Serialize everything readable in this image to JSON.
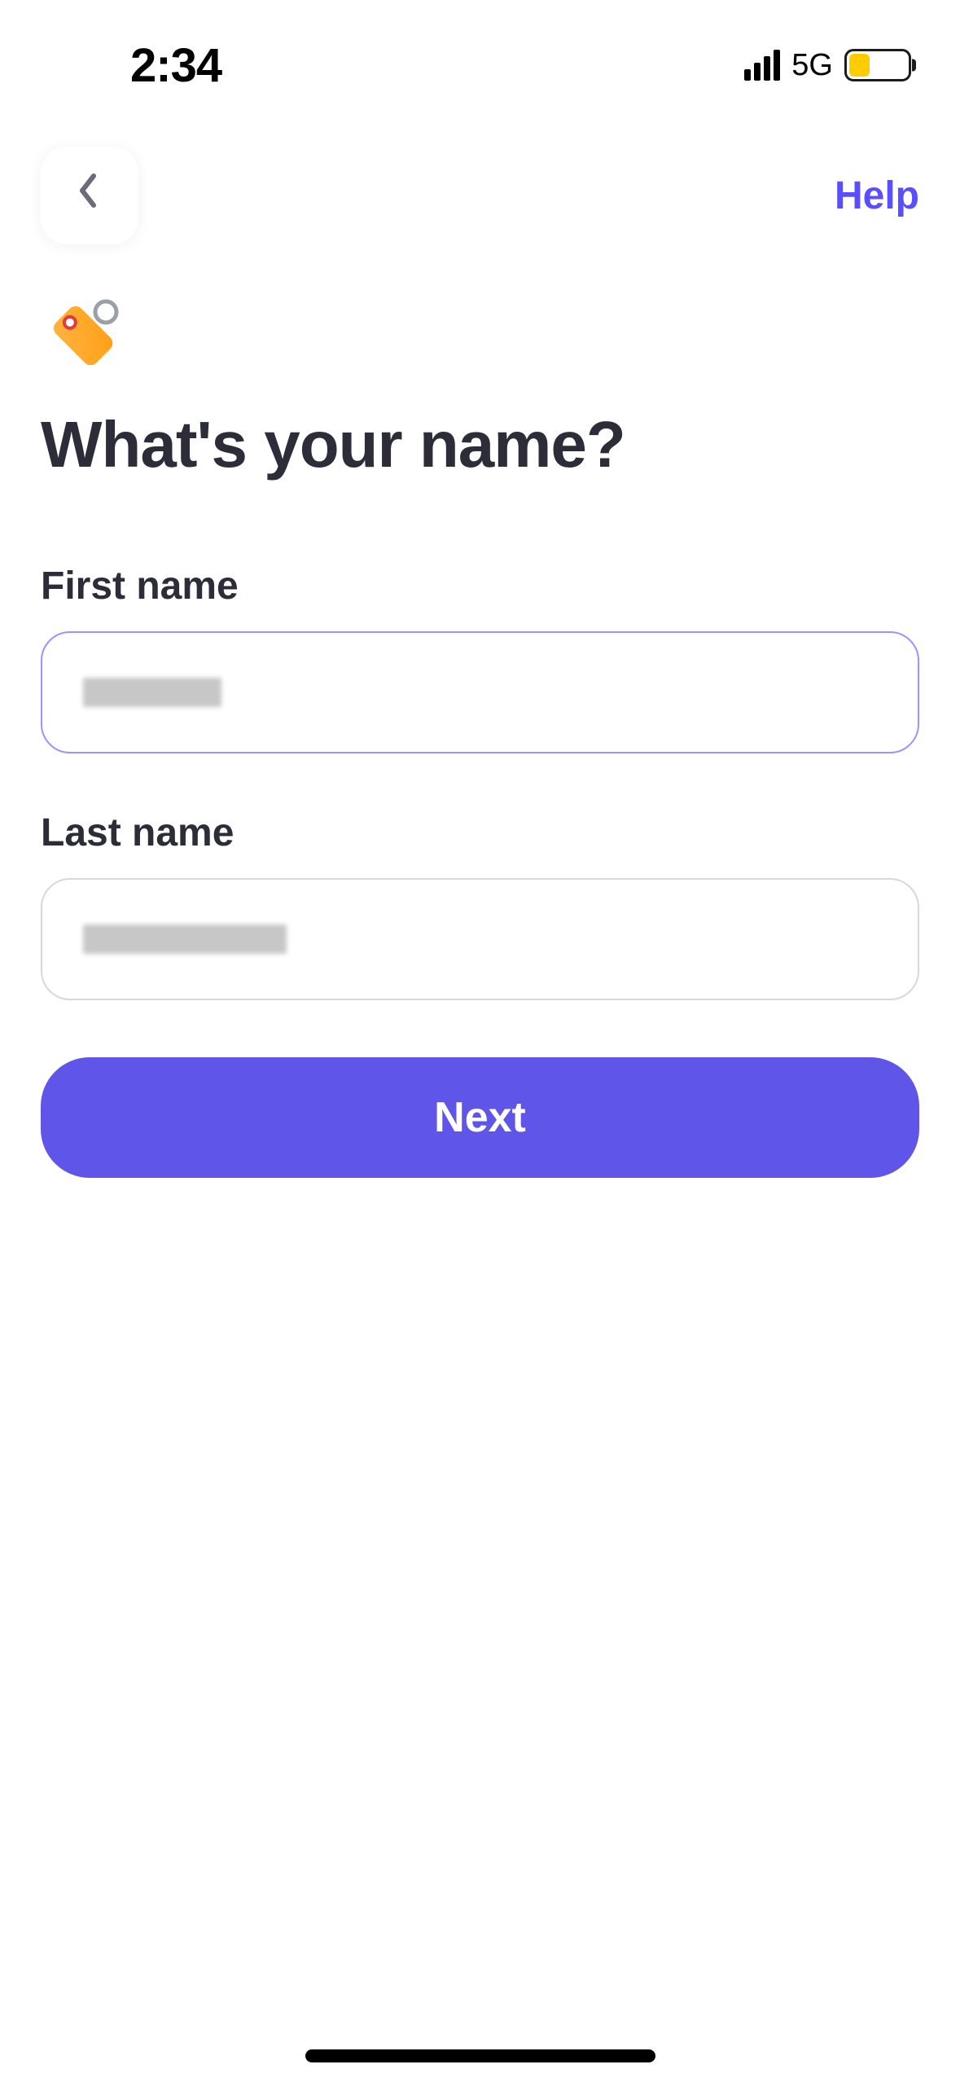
{
  "status_bar": {
    "time": "2:34",
    "network_type": "5G"
  },
  "header": {
    "help_label": "Help"
  },
  "page": {
    "heading": "What's your name?"
  },
  "form": {
    "first_name": {
      "label": "First name",
      "value": ""
    },
    "last_name": {
      "label": "Last name",
      "value": ""
    }
  },
  "actions": {
    "next_label": "Next"
  }
}
